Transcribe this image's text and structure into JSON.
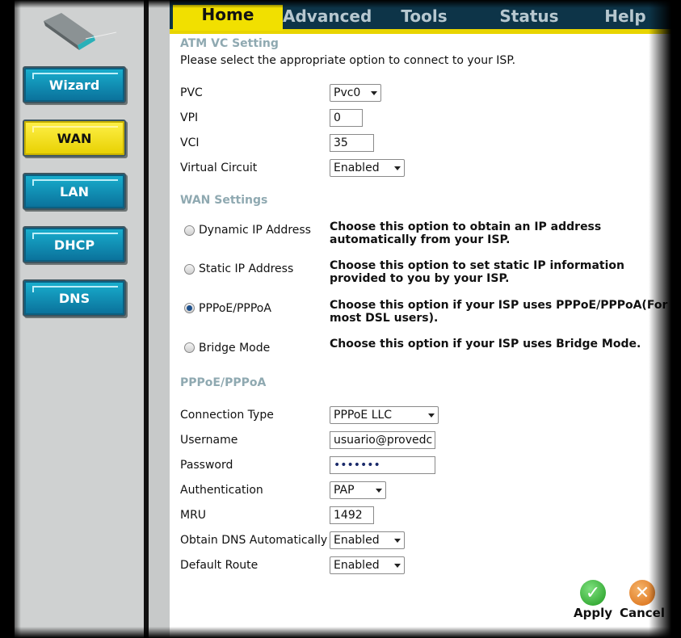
{
  "tabs": [
    {
      "label": "Home",
      "active": true
    },
    {
      "label": "Advanced",
      "active": false
    },
    {
      "label": "Tools",
      "active": false
    },
    {
      "label": "Status",
      "active": false
    },
    {
      "label": "Help",
      "active": false
    }
  ],
  "sidebar": {
    "items": [
      {
        "label": "Wizard",
        "active": false
      },
      {
        "label": "WAN",
        "active": true
      },
      {
        "label": "LAN",
        "active": false
      },
      {
        "label": "DHCP",
        "active": false
      },
      {
        "label": "DNS",
        "active": false
      }
    ]
  },
  "atm": {
    "title": "ATM VC Setting",
    "instruction": "Please select the appropriate option to connect to your ISP.",
    "pvc_label": "PVC",
    "pvc_value": "Pvc0",
    "vpi_label": "VPI",
    "vpi_value": "0",
    "vci_label": "VCI",
    "vci_value": "35",
    "vc_label": "Virtual Circuit",
    "vc_value": "Enabled"
  },
  "wan": {
    "title": "WAN Settings",
    "options": [
      {
        "label": "Dynamic IP Address",
        "desc1": "Choose this option to obtain an IP address",
        "desc2": "automatically from your ISP.",
        "selected": false
      },
      {
        "label": "Static IP Address",
        "desc1": "Choose this option to set static IP information",
        "desc2": "provided to you by your ISP.",
        "selected": false
      },
      {
        "label": "PPPoE/PPPoA",
        "desc1": "Choose this option if your ISP uses PPPoE/PPPoA(For",
        "desc2": "most DSL users).",
        "selected": true
      },
      {
        "label": "Bridge Mode",
        "desc1": "Choose this option if your ISP uses Bridge Mode.",
        "desc2": "",
        "selected": false
      }
    ]
  },
  "pppoe": {
    "title": "PPPoE/PPPoA",
    "conn_type_label": "Connection Type",
    "conn_type_value": "PPPoE LLC",
    "username_label": "Username",
    "username_value": "usuario@provedc",
    "password_label": "Password",
    "password_value": "•••••••",
    "auth_label": "Authentication",
    "auth_value": "PAP",
    "mru_label": "MRU",
    "mru_value": "1492",
    "dns_label": "Obtain DNS Automatically",
    "dns_value": "Enabled",
    "route_label": "Default Route",
    "route_value": "Enabled"
  },
  "actions": {
    "apply": "Apply",
    "cancel": "Cancel"
  },
  "colors": {
    "accent_yellow": "#f1e000",
    "nav_blue": "#0a8fb8",
    "section_title": "#8fa9b1",
    "apply_green": "#2fb52f",
    "cancel_orange": "#e8841c"
  }
}
